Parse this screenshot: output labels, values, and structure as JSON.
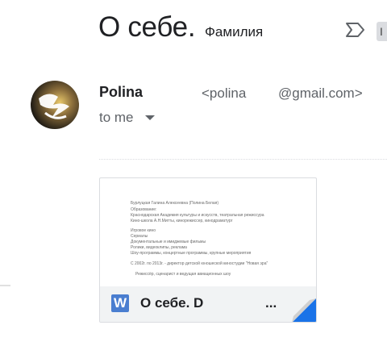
{
  "subject": {
    "title": "О себе.",
    "chip_text": "Фамилия"
  },
  "label_chip": "I",
  "sender": {
    "name": "Polina",
    "email_prefix": "<polina",
    "email_suffix": "@gmail.com>",
    "to_label": "to me"
  },
  "attachment": {
    "name": "О себе. D",
    "name_tail": "...",
    "type_icon": "W",
    "preview_lines": [
      "Бурлуцкая Галина  Алексеевна  (Полина Белая)",
      "Образование:",
      "Краснодарская Академия культуры и искусств, театральная режиссура",
      "Кино-школа А.Н.Митты, кинорежиссер, кинодраматург",
      "Игровое кино",
      "Сериалы",
      "Документальные и имиджевые фильмы",
      "Ролики, видеоклипы, реклама",
      "Шоу-программы, концертные программы, крупные мероприятия",
      "С 2002г. по 2013г. - директор детской юношеской киностудии \"Новая эра\"",
      "Режиссёр, сценарист и ведущая авиационных шоу"
    ]
  },
  "colors": {
    "word_blue": "#4a7ed0",
    "corner_blue": "#1a73e8"
  },
  "icons": {
    "important": "important-marker-icon",
    "caret": "chevron-down-icon"
  }
}
